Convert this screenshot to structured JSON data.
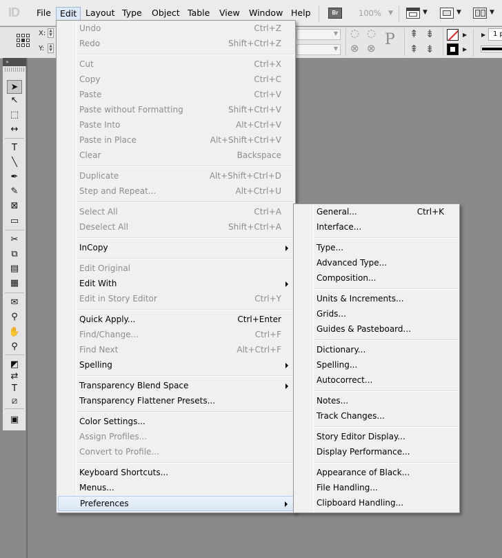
{
  "app": {
    "logo": "ID"
  },
  "menubar": {
    "items": [
      "File",
      "Edit",
      "Layout",
      "Type",
      "Object",
      "Table",
      "View",
      "Window",
      "Help"
    ],
    "bridge_label": "Br",
    "zoom": "100%"
  },
  "control_panel": {
    "x_label": "X:",
    "y_label": "Y:",
    "stroke_weight": "1 p",
    "typography_glyph": "P"
  },
  "edit_menu": {
    "groups": [
      [
        {
          "label": "Undo",
          "shortcut": "Ctrl+Z",
          "enabled": false
        },
        {
          "label": "Redo",
          "shortcut": "Shift+Ctrl+Z",
          "enabled": false
        }
      ],
      [
        {
          "label": "Cut",
          "shortcut": "Ctrl+X",
          "enabled": false
        },
        {
          "label": "Copy",
          "shortcut": "Ctrl+C",
          "enabled": false
        },
        {
          "label": "Paste",
          "shortcut": "Ctrl+V",
          "enabled": false
        },
        {
          "label": "Paste without Formatting",
          "shortcut": "Shift+Ctrl+V",
          "enabled": false
        },
        {
          "label": "Paste Into",
          "shortcut": "Alt+Ctrl+V",
          "enabled": false
        },
        {
          "label": "Paste in Place",
          "shortcut": "Alt+Shift+Ctrl+V",
          "enabled": false
        },
        {
          "label": "Clear",
          "shortcut": "Backspace",
          "enabled": false
        }
      ],
      [
        {
          "label": "Duplicate",
          "shortcut": "Alt+Shift+Ctrl+D",
          "enabled": false
        },
        {
          "label": "Step and Repeat...",
          "shortcut": "Alt+Ctrl+U",
          "enabled": false
        }
      ],
      [
        {
          "label": "Select All",
          "shortcut": "Ctrl+A",
          "enabled": false
        },
        {
          "label": "Deselect All",
          "shortcut": "Shift+Ctrl+A",
          "enabled": false
        }
      ],
      [
        {
          "label": "InCopy",
          "shortcut": "",
          "enabled": true,
          "submenu": true
        }
      ],
      [
        {
          "label": "Edit Original",
          "shortcut": "",
          "enabled": false
        },
        {
          "label": "Edit With",
          "shortcut": "",
          "enabled": true,
          "submenu": true
        },
        {
          "label": "Edit in Story Editor",
          "shortcut": "Ctrl+Y",
          "enabled": false
        }
      ],
      [
        {
          "label": "Quick Apply...",
          "shortcut": "Ctrl+Enter",
          "enabled": true
        },
        {
          "label": "Find/Change...",
          "shortcut": "Ctrl+F",
          "enabled": false
        },
        {
          "label": "Find Next",
          "shortcut": "Alt+Ctrl+F",
          "enabled": false
        },
        {
          "label": "Spelling",
          "shortcut": "",
          "enabled": true,
          "submenu": true
        }
      ],
      [
        {
          "label": "Transparency Blend Space",
          "shortcut": "",
          "enabled": true,
          "submenu": true
        },
        {
          "label": "Transparency Flattener Presets...",
          "shortcut": "",
          "enabled": true
        }
      ],
      [
        {
          "label": "Color Settings...",
          "shortcut": "",
          "enabled": true
        },
        {
          "label": "Assign Profiles...",
          "shortcut": "",
          "enabled": false
        },
        {
          "label": "Convert to Profile...",
          "shortcut": "",
          "enabled": false
        }
      ],
      [
        {
          "label": "Keyboard Shortcuts...",
          "shortcut": "",
          "enabled": true
        },
        {
          "label": "Menus...",
          "shortcut": "",
          "enabled": true
        },
        {
          "label": "Preferences",
          "shortcut": "",
          "enabled": true,
          "submenu": true,
          "highlighted": true
        }
      ]
    ]
  },
  "preferences_menu": {
    "groups": [
      [
        {
          "label": "General...",
          "shortcut": "Ctrl+K"
        },
        {
          "label": "Interface...",
          "shortcut": ""
        }
      ],
      [
        {
          "label": "Type...",
          "shortcut": ""
        },
        {
          "label": "Advanced Type...",
          "shortcut": ""
        },
        {
          "label": "Composition...",
          "shortcut": ""
        }
      ],
      [
        {
          "label": "Units & Increments...",
          "shortcut": ""
        },
        {
          "label": "Grids...",
          "shortcut": ""
        },
        {
          "label": "Guides & Pasteboard...",
          "shortcut": ""
        }
      ],
      [
        {
          "label": "Dictionary...",
          "shortcut": ""
        },
        {
          "label": "Spelling...",
          "shortcut": ""
        },
        {
          "label": "Autocorrect...",
          "shortcut": ""
        }
      ],
      [
        {
          "label": "Notes...",
          "shortcut": ""
        },
        {
          "label": "Track Changes...",
          "shortcut": ""
        }
      ],
      [
        {
          "label": "Story Editor Display...",
          "shortcut": ""
        },
        {
          "label": "Display Performance...",
          "shortcut": ""
        }
      ],
      [
        {
          "label": "Appearance of Black...",
          "shortcut": ""
        },
        {
          "label": "File Handling...",
          "shortcut": ""
        },
        {
          "label": "Clipboard Handling...",
          "shortcut": ""
        }
      ]
    ]
  },
  "tools": [
    {
      "icon": "selection-tool-icon",
      "glyph": "➤",
      "selected": true
    },
    {
      "icon": "direct-selection-tool-icon",
      "glyph": "↖"
    },
    {
      "icon": "page-tool-icon",
      "glyph": "⬚"
    },
    {
      "icon": "gap-tool-icon",
      "glyph": "↔"
    },
    {
      "icon": "type-tool-icon",
      "glyph": "T"
    },
    {
      "icon": "line-tool-icon",
      "glyph": "╲"
    },
    {
      "icon": "pen-tool-icon",
      "glyph": "✒"
    },
    {
      "icon": "pencil-tool-icon",
      "glyph": "✎"
    },
    {
      "icon": "rectangle-frame-tool-icon",
      "glyph": "⊠"
    },
    {
      "icon": "rectangle-tool-icon",
      "glyph": "▭"
    },
    {
      "icon": "scissors-tool-icon",
      "glyph": "✂"
    },
    {
      "icon": "free-transform-tool-icon",
      "glyph": "⧉"
    },
    {
      "icon": "gradient-swatch-tool-icon",
      "glyph": "▤"
    },
    {
      "icon": "gradient-feather-tool-icon",
      "glyph": "▦"
    },
    {
      "icon": "note-tool-icon",
      "glyph": "✉"
    },
    {
      "icon": "eyedropper-tool-icon",
      "glyph": "⚲"
    },
    {
      "icon": "hand-tool-icon",
      "glyph": "✋"
    },
    {
      "icon": "zoom-tool-icon",
      "glyph": "⚲"
    },
    {
      "icon": "fill-stroke-icon",
      "glyph": "◩"
    },
    {
      "icon": "swap-fill-stroke-icon",
      "glyph": "⇄"
    },
    {
      "icon": "formatting-affects-icon",
      "glyph": "T"
    },
    {
      "icon": "apply-none-icon",
      "glyph": "⧄"
    },
    {
      "icon": "screen-mode-icon",
      "glyph": "▣"
    }
  ]
}
